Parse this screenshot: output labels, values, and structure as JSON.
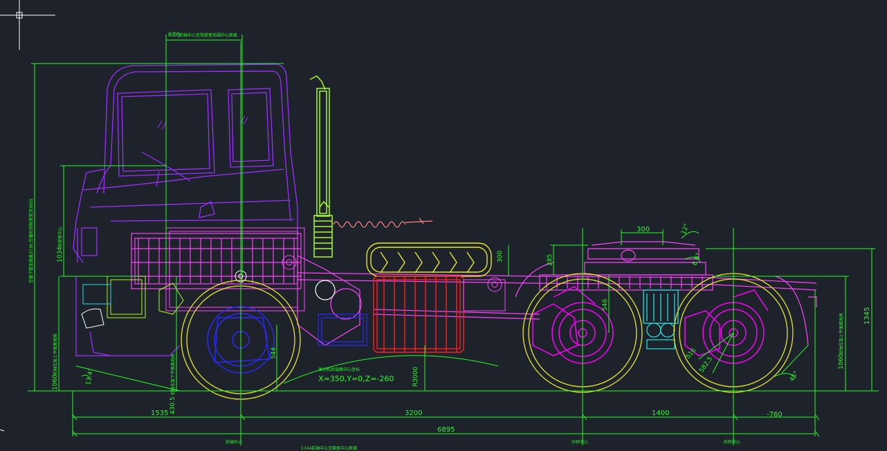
{
  "drawing": {
    "dimensions": {
      "front_overhang": "1535",
      "wheelbase_1": "3200",
      "wheelbase_2": "1400",
      "rear_overhang": "-760",
      "overall_length": "6895",
      "fifth_wheel_width": "300",
      "tilt_angle": "12°",
      "tilt_angle_2": "8.6°",
      "kingpin_height": "285",
      "tire_dim": "300",
      "ground_clear_3000": "R3000",
      "frame_546": "546",
      "dim_544": "544",
      "dim_516": "516",
      "dim_582": "582.5",
      "angle_45": "45°",
      "angle_13": "13.4°",
      "height_1345": "1345",
      "height_1060_rear": "1060",
      "height_1060_front": "1060",
      "height_1034": "1034",
      "height_430": "430.5"
    },
    "labels": {
      "top_dim": "686",
      "top_dim_note": "前轴中心至驾驶室后围中心距离",
      "vertical_total": "空载下整车高度3730;空载时到驾驶室顶3955",
      "vertical_1034_note": "驾驶室中心",
      "vertical_1060_front_note": "前轴车架上平面离地高",
      "vertical_1060_rear_note": "后轴车架上平面离地高",
      "vertical_430_note": "前轴车架下平面离地高",
      "gear_note": "发动机后端面中心坐标",
      "coord_text": "X=350,Y=0,Z=-260",
      "bottom_note": "1744前轴中心至鞍座中心距离",
      "front_axle_tag": "前轴中心",
      "mid_axle_tag": "中桥中心",
      "rear_axle_tag": "后桥中心"
    },
    "colors": {
      "background": "#1e232b",
      "dimension": "#22ff22",
      "cab": "#9b30ff",
      "frame": "#ff44ff",
      "wheel": "#e8e82a",
      "exhaust": "#aaff22",
      "tank": "#ff2020",
      "axle": "#ff00ff",
      "suspension": "#22e0e0",
      "engine_block": "#2a2aff"
    }
  }
}
